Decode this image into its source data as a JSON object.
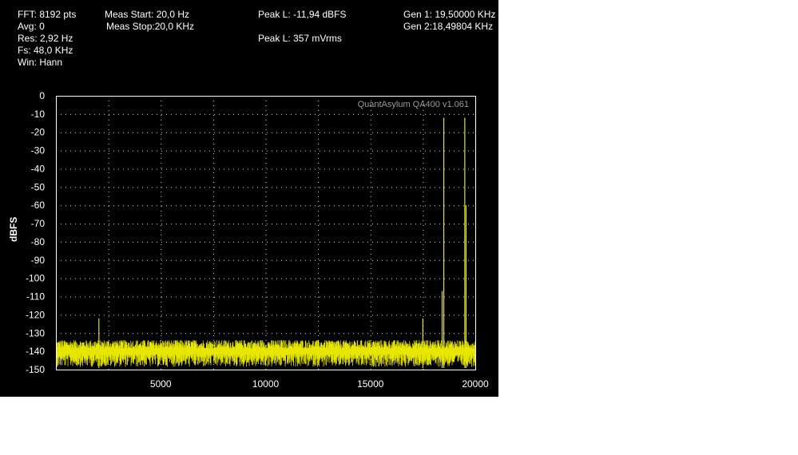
{
  "header": {
    "fft": "FFT: 8192 pts",
    "avg": "Avg: 0",
    "res": "Res: 2,92 Hz",
    "fs": "Fs: 48,0 KHz",
    "win": "Win: Hann",
    "meas_start": "Meas Start: 20,0 Hz",
    "meas_stop": "Meas Stop:20,0 KHz",
    "peak_dbfs": "Peak L: -11,94 dBFS",
    "peak_mvrms": "Peak L: 357 mVrms",
    "gen1": "Gen 1: 19,50000 KHz",
    "gen2": "Gen 2:18,49804 KHz"
  },
  "chart_data": {
    "type": "line",
    "title": "",
    "watermark": "QuantAsylum QA400 v1.061",
    "xlabel": "",
    "ylabel": "dBFS",
    "xlim": [
      0,
      20000
    ],
    "ylim": [
      -150,
      0
    ],
    "x_ticks": [
      5000,
      10000,
      15000,
      20000
    ],
    "y_ticks": [
      0,
      -10,
      -20,
      -30,
      -40,
      -50,
      -60,
      -70,
      -80,
      -90,
      -100,
      -110,
      -120,
      -130,
      -140,
      -150
    ],
    "grid": true,
    "noise_floor": {
      "mean": -140,
      "spread": 5,
      "peak_min": -134,
      "trough_max": -150
    },
    "series": [
      {
        "color": "#e6e600",
        "peaks": [
          {
            "x": 2050,
            "y": -122
          },
          {
            "x": 17500,
            "y": -122
          },
          {
            "x": 18498,
            "y": -12
          },
          {
            "x": 19500,
            "y": -12
          },
          {
            "x": 19560,
            "y": -60
          },
          {
            "x": 18420,
            "y": -107
          }
        ]
      }
    ],
    "colors": {
      "background": "#000000",
      "plot_border": "#ffffff",
      "grid": "#d8d8d8",
      "trace": "#e6e600",
      "text": "#ffffff",
      "watermark": "#9a9a9a"
    }
  }
}
